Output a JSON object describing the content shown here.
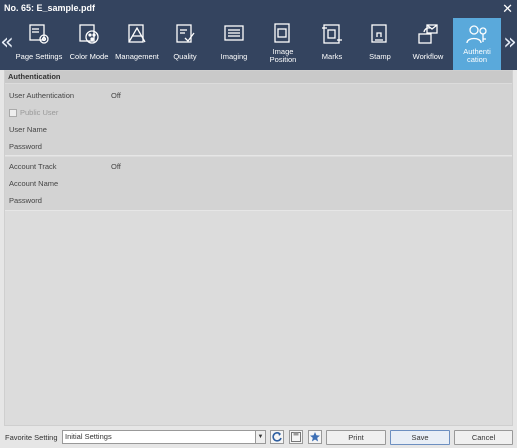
{
  "window": {
    "title": "No. 65: E_sample.pdf"
  },
  "toolbar": {
    "tabs": [
      {
        "label": "Page Settings",
        "icon": "page-settings-icon"
      },
      {
        "label": "Color Mode",
        "icon": "color-mode-icon"
      },
      {
        "label": "Management",
        "icon": "management-icon"
      },
      {
        "label": "Quality",
        "icon": "quality-icon"
      },
      {
        "label": "Imaging",
        "icon": "imaging-icon"
      },
      {
        "label": "Image Position",
        "icon": "image-position-icon"
      },
      {
        "label": "Marks",
        "icon": "marks-icon"
      },
      {
        "label": "Stamp",
        "icon": "stamp-icon"
      },
      {
        "label": "Workflow",
        "icon": "workflow-icon"
      },
      {
        "label": "Authentication",
        "label_line1": "Authenti",
        "label_line2": "cation",
        "icon": "authentication-icon",
        "active": true
      }
    ],
    "nav_left": "«",
    "nav_right": "»",
    "active_color": "#5aa9db",
    "bar_color": "#34445f"
  },
  "section": {
    "title": "Authentication",
    "auth_group": {
      "user_auth_label": "User Authentication",
      "user_auth_value": "Off",
      "public_user_label": "Public User",
      "user_name_label": "User Name",
      "password_label": "Password"
    },
    "account_group": {
      "account_track_label": "Account Track",
      "account_track_value": "Off",
      "account_name_label": "Account Name",
      "password_label": "Password"
    }
  },
  "footer": {
    "favorite_label": "Favorite Setting",
    "favorite_value": "Initial Settings",
    "print_label": "Print",
    "save_label": "Save",
    "cancel_label": "Cancel"
  }
}
